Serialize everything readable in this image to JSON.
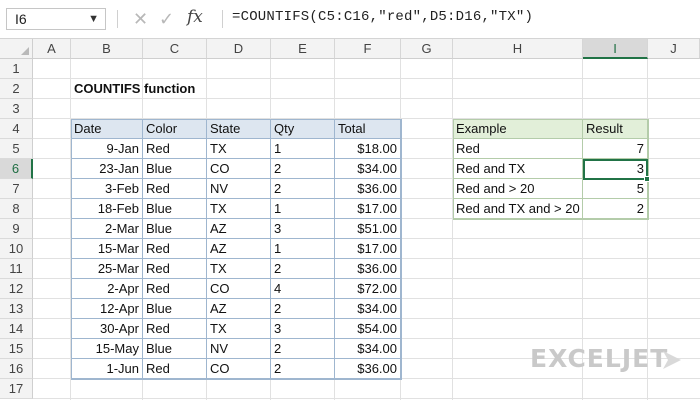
{
  "formula_bar": {
    "name_box": "I6",
    "cancel_icon": "x-icon",
    "enter_icon": "check-icon",
    "fx_label": "fx",
    "formula": "=COUNTIFS(C5:C16,\"red\",D5:D16,\"TX\")"
  },
  "columns": [
    "A",
    "B",
    "C",
    "D",
    "E",
    "F",
    "G",
    "H",
    "I",
    "J"
  ],
  "rows": [
    "1",
    "2",
    "3",
    "4",
    "5",
    "6",
    "7",
    "8",
    "9",
    "10",
    "11",
    "12",
    "13",
    "14",
    "15",
    "16",
    "17"
  ],
  "selected": {
    "column": "I",
    "row": "6"
  },
  "sheet": {
    "title": "COUNTIFS function",
    "table": {
      "headers": [
        "Date",
        "Color",
        "State",
        "Qty",
        "Total"
      ],
      "rows": [
        [
          "9-Jan",
          "Red",
          "TX",
          "1",
          "$18.00"
        ],
        [
          "23-Jan",
          "Blue",
          "CO",
          "2",
          "$34.00"
        ],
        [
          "3-Feb",
          "Red",
          "NV",
          "2",
          "$36.00"
        ],
        [
          "18-Feb",
          "Blue",
          "TX",
          "1",
          "$17.00"
        ],
        [
          "2-Mar",
          "Blue",
          "AZ",
          "3",
          "$51.00"
        ],
        [
          "15-Mar",
          "Red",
          "AZ",
          "1",
          "$17.00"
        ],
        [
          "25-Mar",
          "Red",
          "TX",
          "2",
          "$36.00"
        ],
        [
          "2-Apr",
          "Red",
          "CO",
          "4",
          "$72.00"
        ],
        [
          "12-Apr",
          "Blue",
          "AZ",
          "2",
          "$34.00"
        ],
        [
          "30-Apr",
          "Red",
          "TX",
          "3",
          "$54.00"
        ],
        [
          "15-May",
          "Blue",
          "NV",
          "2",
          "$34.00"
        ],
        [
          "1-Jun",
          "Red",
          "CO",
          "2",
          "$36.00"
        ]
      ]
    },
    "summary": {
      "headers": [
        "Example",
        "Result"
      ],
      "rows": [
        [
          "Red",
          "7"
        ],
        [
          "Red and TX",
          "3"
        ],
        [
          "Red and > 20",
          "5"
        ],
        [
          "Red and TX and > 20",
          "2"
        ]
      ]
    }
  },
  "branding": {
    "logo_text": "EXCELJET"
  },
  "colors": {
    "table_header": "#dde6f0",
    "summary_header": "#e2efd9",
    "selection": "#217346"
  }
}
